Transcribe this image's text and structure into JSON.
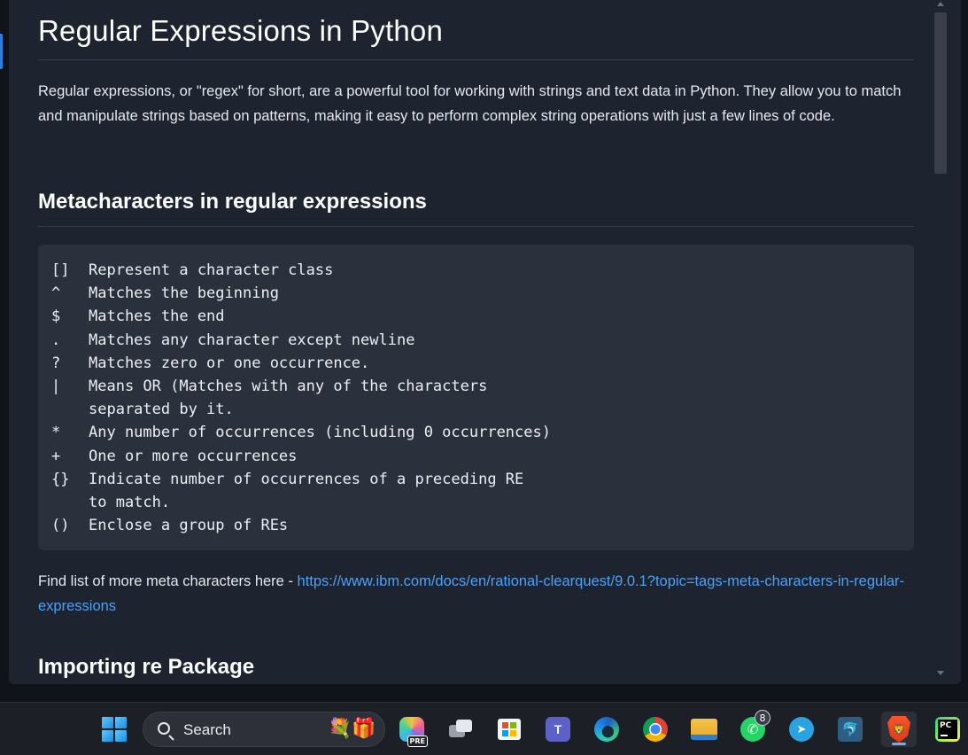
{
  "article": {
    "title": "Regular Expressions in Python",
    "intro": "Regular expressions, or \"regex\" for short, are a powerful tool for working with strings and text data in Python. They allow you to match and manipulate strings based on patterns, making it easy to perform complex string operations with just a few lines of code.",
    "section_metachar_heading": "Metacharacters in regular expressions",
    "metacharacters": [
      {
        "symbol": "[]",
        "description": "Represent a character class"
      },
      {
        "symbol": "^",
        "description": "Matches the beginning"
      },
      {
        "symbol": "$",
        "description": "Matches the end"
      },
      {
        "symbol": ".",
        "description": "Matches any character except newline"
      },
      {
        "symbol": "?",
        "description": "Matches zero or one occurrence."
      },
      {
        "symbol": "|",
        "description": "Means OR (Matches with any of the characters"
      },
      {
        "symbol": "",
        "description": "separated by it."
      },
      {
        "symbol": "*",
        "description": "Any number of occurrences (including 0 occurrences)"
      },
      {
        "symbol": "+",
        "description": "One or more occurrences"
      },
      {
        "symbol": "{}",
        "description": "Indicate number of occurrences of a preceding RE"
      },
      {
        "symbol": "",
        "description": "to match."
      },
      {
        "symbol": "()",
        "description": "Enclose a group of REs"
      }
    ],
    "find_list_text": "Find list of more meta characters here - ",
    "find_list_link": "https://www.ibm.com/docs/en/rational-clearquest/9.0.1?topic=tags-meta-characters-in-regular-expressions",
    "section_import_heading": "Importing re Package"
  },
  "taskbar": {
    "search_placeholder": "Search",
    "copilot_badge": "PRE",
    "whatsapp_badge": "8",
    "pycharm_label": "PC",
    "items": [
      "start-icon",
      "copilot-icon",
      "task-view-icon",
      "microsoft-store-icon",
      "teams-icon",
      "edge-icon",
      "chrome-icon",
      "file-explorer-icon",
      "whatsapp-icon",
      "telegram-icon",
      "mysql-workbench-icon",
      "brave-icon",
      "pycharm-icon"
    ]
  },
  "colors": {
    "page_bg": "#1e2330",
    "code_bg": "#2b303d",
    "link": "#4ea0f5",
    "taskbar_bg": "#1c1f26"
  }
}
